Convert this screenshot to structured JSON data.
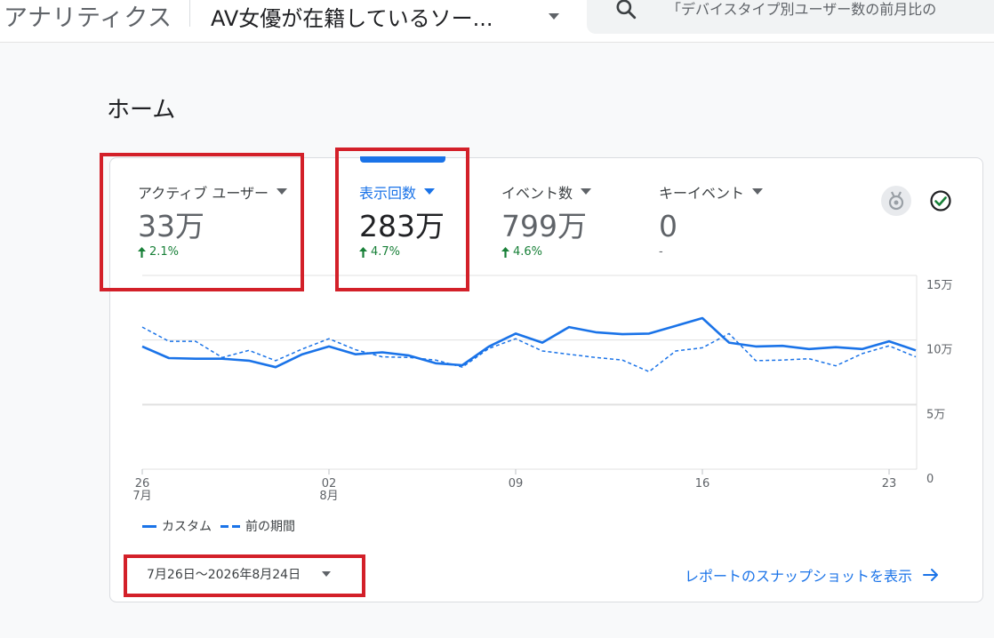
{
  "header": {
    "app_title": "アナリティクス",
    "property_name": "AV女優が在籍しているソー...",
    "search_placeholder": "「デバイスタイプ別ユーザー数の前月比の"
  },
  "page": {
    "title": "ホーム"
  },
  "metrics": [
    {
      "label": "アクティブ ユーザー",
      "value": "33万",
      "change": "2.1%",
      "trend": "up",
      "active": false
    },
    {
      "label": "表示回数",
      "value": "283万",
      "change": "4.7%",
      "trend": "up",
      "active": true
    },
    {
      "label": "イベント数",
      "value": "799万",
      "change": "4.6%",
      "trend": "up",
      "active": false
    },
    {
      "label": "キーイベント",
      "value": "0",
      "change": "-",
      "trend": "none",
      "active": false
    }
  ],
  "colors": {
    "accent": "#1a73e8",
    "series_main": "#1a73e8",
    "series_prev": "#1a73e8",
    "positive": "#188038",
    "annotation": "#d32029"
  },
  "icons": {
    "insight": "medal-icon",
    "status": "check-circle-icon"
  },
  "chart_data": {
    "type": "line",
    "x_tick_labels": [
      {
        "day": "26",
        "month": "7月"
      },
      {
        "day": "02",
        "month": "8月"
      },
      {
        "day": "09",
        "month": ""
      },
      {
        "day": "16",
        "month": ""
      },
      {
        "day": "23",
        "month": ""
      }
    ],
    "y_tick_labels": [
      "15万",
      "10万",
      "5万",
      "0"
    ],
    "ylim": [
      0,
      150000
    ],
    "x_dates": [
      "07-26",
      "07-27",
      "07-28",
      "07-29",
      "07-30",
      "07-31",
      "08-01",
      "08-02",
      "08-03",
      "08-04",
      "08-05",
      "08-06",
      "08-07",
      "08-08",
      "08-09",
      "08-10",
      "08-11",
      "08-12",
      "08-13",
      "08-14",
      "08-15",
      "08-16",
      "08-17",
      "08-18",
      "08-19",
      "08-20",
      "08-21",
      "08-22",
      "08-23",
      "08-24"
    ],
    "series": [
      {
        "name": "カスタム",
        "style": "solid",
        "values": [
          95000,
          86000,
          85500,
          85500,
          84000,
          79000,
          89000,
          95000,
          89000,
          90500,
          88000,
          82000,
          80500,
          95000,
          105000,
          98000,
          110000,
          106000,
          104500,
          105000,
          111000,
          117000,
          98000,
          95000,
          95500,
          93000,
          94500,
          93000,
          99000,
          92000
        ]
      },
      {
        "name": "前の期間",
        "style": "dashed",
        "values": [
          110000,
          99000,
          99000,
          86500,
          92000,
          84000,
          93000,
          101000,
          92500,
          87000,
          86500,
          84500,
          79000,
          93500,
          101000,
          91500,
          89000,
          86500,
          84500,
          75500,
          91500,
          94000,
          105000,
          84000,
          84500,
          85500,
          80000,
          89500,
          95500,
          87000
        ]
      }
    ]
  },
  "legend": [
    {
      "label": "カスタム",
      "style": "solid"
    },
    {
      "label": "前の期間",
      "style": "dashed"
    }
  ],
  "footer": {
    "date_range": "7月26日〜2026年8月24日",
    "snapshot_link": "レポートのスナップショットを表示"
  }
}
